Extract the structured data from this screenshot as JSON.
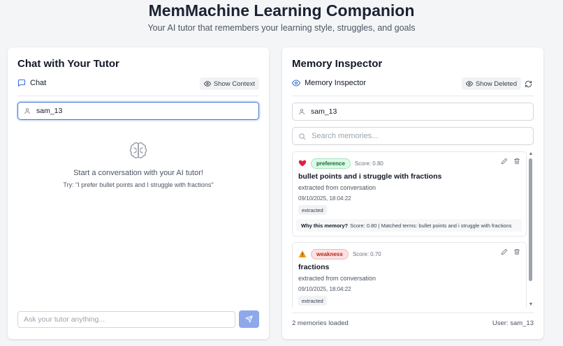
{
  "header": {
    "title": "MemMachine Learning Companion",
    "subtitle": "Your AI tutor that remembers your learning style, struggles, and goals"
  },
  "chat": {
    "title": "Chat with Your Tutor",
    "tab_label": "Chat",
    "show_context_label": "Show Context",
    "user_value": "sam_13",
    "empty_message": "Start a conversation with your AI tutor!",
    "empty_hint": "Try: \"I prefer bullet points and I struggle with fractions\"",
    "input_placeholder": "Ask your tutor anything..."
  },
  "memory": {
    "title": "Memory Inspector",
    "tab_label": "Memory Inspector",
    "show_deleted_label": "Show Deleted",
    "user_value": "sam_13",
    "search_placeholder": "Search memories...",
    "items": [
      {
        "badge": "preference",
        "score": "Score: 0.80",
        "content": "bullet points and i struggle with fractions",
        "source": "extracted from conversation",
        "date": "09/10/2025, 18:04:22",
        "tag": "extracted",
        "why_label": "Why this memory?",
        "why_text": "Score: 0.80 | Matched terms: bullet points and i struggle with fractions"
      },
      {
        "badge": "weakness",
        "score": "Score: 0.70",
        "content": "fractions",
        "source": "extracted from conversation",
        "date": "09/10/2025, 18:04:22",
        "tag": "extracted"
      }
    ],
    "footer_count": "2 memories loaded",
    "footer_user": "User: sam_13"
  },
  "colors": {
    "accent": "#3b6fd6",
    "send_button": "#8ea8ec",
    "preference_badge": "#dcfce7",
    "weakness_badge": "#fde2e2"
  },
  "icons": {
    "chat_tab": "chat-bubble-icon",
    "memory_tab": "eye-icon",
    "user": "user-icon",
    "search": "search-icon",
    "empty_state": "brain-icon",
    "send": "send-icon",
    "refresh": "refresh-icon",
    "preference": "heart-icon",
    "weakness": "warning-icon",
    "edit": "pencil-icon",
    "delete": "trash-icon"
  }
}
